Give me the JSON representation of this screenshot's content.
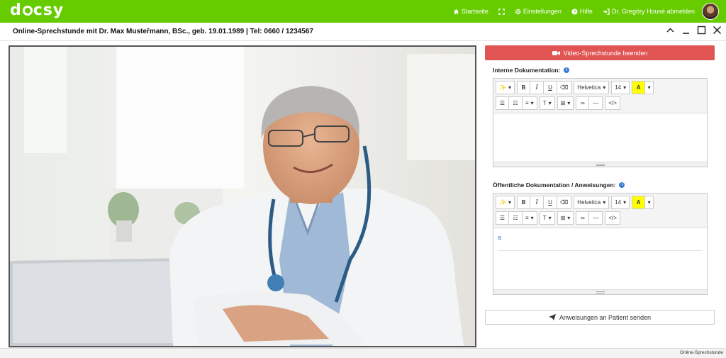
{
  "app": {
    "logo": "docsy"
  },
  "nav": {
    "home": "Startseite",
    "settings": "Einstellungen",
    "help": "Hilfe",
    "logout": "Dr. Gregöry Housé abmelden"
  },
  "session": {
    "title": "Online-Sprechstunde mit Dr. Max Musteřmann, BSc., geb. 19.01.1989 | Tel: 0660 / 1234567"
  },
  "panel": {
    "end_video_label": "Video-Sprechstunde beenden",
    "internal_doc_label": "Interne Dokumentation:",
    "public_doc_label": "Öffentliche Dokumentation / Anweisungen:",
    "public_doc_content": "a",
    "send_label": "Anweisungen an Patient senden"
  },
  "editor": {
    "font": "Helvetica",
    "size": "14",
    "highlight": "A",
    "bold": "B",
    "italic": "I",
    "underline": "U",
    "text_style": "T",
    "code": "</>"
  },
  "status": {
    "label": "Online-Sprechstunde"
  },
  "colors": {
    "brand": "#66cc00",
    "danger": "#e05554",
    "info": "#3a7bd5"
  }
}
